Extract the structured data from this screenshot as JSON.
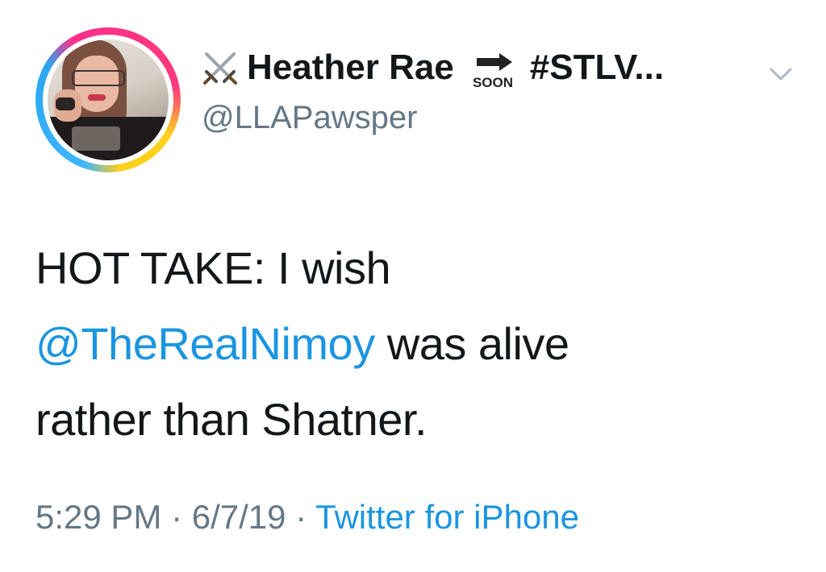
{
  "author": {
    "display_name": "Heather Rae",
    "hashtag": "#STLV...",
    "handle": "@LLAPawsper",
    "emoji_1": "crossed-swords-icon",
    "emoji_2": "soon-arrow-icon",
    "emoji_2_text": "SOON"
  },
  "tweet": {
    "line1": "HOT TAKE: I wish",
    "mention": "@TheRealNimoy",
    "line2_rest": " was alive",
    "line3": "rather than Shatner."
  },
  "meta": {
    "time": "5:29 PM",
    "date": "6/7/19",
    "sep": " · ",
    "source": "Twitter for iPhone"
  },
  "colors": {
    "link": "#1b95e0",
    "muted": "#657786",
    "text": "#14171a"
  }
}
